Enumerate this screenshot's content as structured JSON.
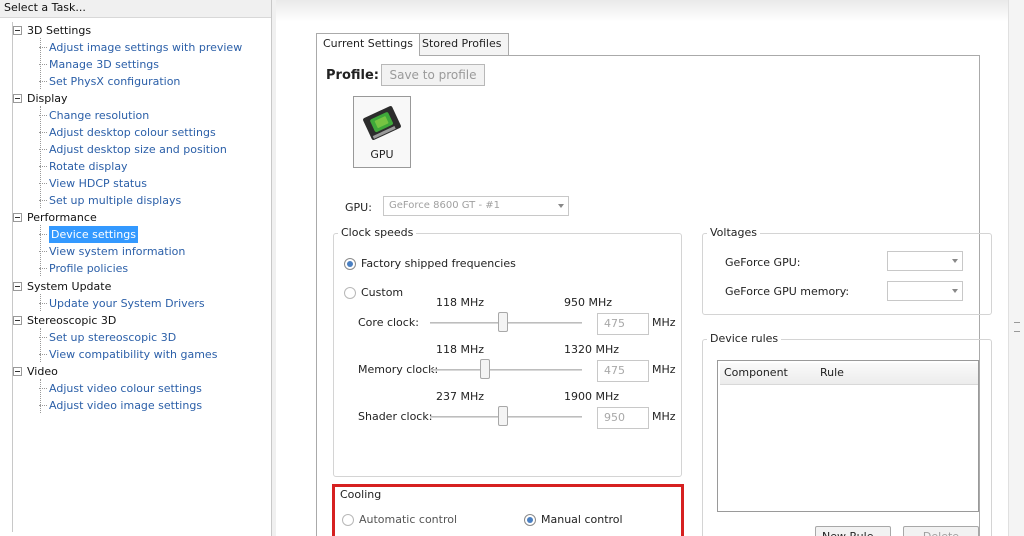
{
  "left_pane": {
    "header": "Select a Task...",
    "categories": [
      {
        "label": "3D Settings",
        "items": [
          "Adjust image settings with preview",
          "Manage 3D settings",
          "Set PhysX configuration"
        ]
      },
      {
        "label": "Display",
        "items": [
          "Change resolution",
          "Adjust desktop colour settings",
          "Adjust desktop size and position",
          "Rotate display",
          "View HDCP status",
          "Set up multiple displays"
        ]
      },
      {
        "label": "Performance",
        "items": [
          "Device settings",
          "View system information",
          "Profile policies"
        ]
      },
      {
        "label": "System Update",
        "items": [
          "Update your System Drivers"
        ]
      },
      {
        "label": "Stereoscopic 3D",
        "items": [
          "Set up stereoscopic 3D",
          "View compatibility with games"
        ]
      },
      {
        "label": "Video",
        "items": [
          "Adjust video colour settings",
          "Adjust video image settings"
        ]
      }
    ],
    "selected_item": "Device settings"
  },
  "tabs": [
    "Current Settings",
    "Stored Profiles"
  ],
  "profile": {
    "label": "Profile:",
    "save_button": "Save to profile"
  },
  "gpu_tile": {
    "caption": "GPU",
    "icon": "gpu-icon"
  },
  "gpu_select": {
    "label": "GPU:",
    "value": "GeForce 8600 GT - #1"
  },
  "clock_speeds": {
    "title": "Clock speeds",
    "options": [
      "Factory shipped frequencies",
      "Custom"
    ],
    "selected": "Factory shipped frequencies",
    "unit": "MHz",
    "clocks": [
      {
        "label": "Core clock:",
        "min": "118 MHz",
        "max": "950 MHz",
        "value": "475"
      },
      {
        "label": "Memory clock:",
        "min": "118 MHz",
        "max": "1320 MHz",
        "value": "475"
      },
      {
        "label": "Shader clock:",
        "min": "237 MHz",
        "max": "1900 MHz",
        "value": "950"
      }
    ]
  },
  "voltages": {
    "title": "Voltages",
    "rows": [
      "GeForce GPU:",
      "GeForce GPU memory:"
    ]
  },
  "device_rules": {
    "title": "Device rules",
    "columns": [
      "Component",
      "Rule"
    ],
    "new_rule_button": "New Rule...",
    "delete_button": "Delete"
  },
  "cooling": {
    "title": "Cooling",
    "options": [
      "Automatic control",
      "Manual control"
    ],
    "selected": "Manual control",
    "highlight_color": "#d62020"
  },
  "colors": {
    "link": "#2b5fa8",
    "selection": "#3399ff"
  }
}
